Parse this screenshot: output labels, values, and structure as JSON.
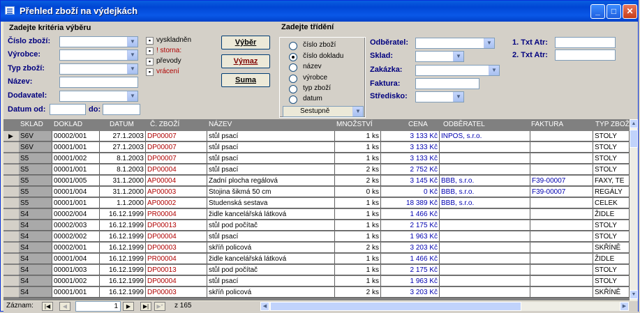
{
  "window": {
    "title": "Přehled zboží na výdejkách"
  },
  "criteria": {
    "heading": "Zadejte kritéria výběru",
    "cislo_zbozi": "Číslo zboží:",
    "vyrobce": "Výrobce:",
    "typ_zbozi": "Typ zboží:",
    "nazev": "Název:",
    "dodavatel": "Dodavatel:",
    "datum_od": "Datum od:",
    "do": "do:"
  },
  "checks": [
    {
      "label": "vyskladněn",
      "color": "#000000"
    },
    {
      "label": "! storna:",
      "color": "#b00000"
    },
    {
      "label": "převody",
      "color": "#000000"
    },
    {
      "label": "vrácení",
      "color": "#b00000"
    }
  ],
  "buttons": {
    "vyber": "Výběr",
    "vymaz": "Výmaz",
    "suma": "Suma"
  },
  "sort": {
    "heading": "Zadejte třídění",
    "options": [
      "číslo zboží",
      "číslo dokladu",
      "název",
      "výrobce",
      "typ zboží",
      "datum"
    ],
    "selected": "číslo dokladu",
    "order": "Sestupně"
  },
  "filters": {
    "odberatel": "Odběratel:",
    "sklad": "Sklad:",
    "zakazka": "Zakázka:",
    "faktura": "Faktura:",
    "stredisko": "Středisko:",
    "txt1": "1. Txt Atr:",
    "txt2": "2. Txt Atr:"
  },
  "grid": {
    "columns": [
      "SKLAD",
      "DOKLAD",
      "DATUM",
      "Č. ZBOŽÍ",
      "NÁZEV",
      "MNOŽSTVÍ",
      "CENA",
      "ODBĚRATEL",
      "FAKTURA",
      "TYP ZBOŽÍ"
    ],
    "rows": [
      [
        "S6V",
        "00002/001",
        "27.1.2003",
        "DP00007",
        "stůl psací",
        "1 ks",
        "3 133 Kč",
        "INPOS, s.r.o.",
        "",
        "STOLY"
      ],
      [
        "S6V",
        "00001/001",
        "27.1.2003",
        "DP00007",
        "stůl psací",
        "1 ks",
        "3 133 Kč",
        "",
        "",
        "STOLY"
      ],
      [
        "S5",
        "00001/002",
        "8.1.2003",
        "DP00007",
        "stůl psací",
        "1 ks",
        "3 133 Kč",
        "",
        "",
        "STOLY"
      ],
      [
        "S5",
        "00001/001",
        "8.1.2003",
        "DP00004",
        "stůl psací",
        "2 ks",
        "2 752 Kč",
        "",
        "",
        "STOLY"
      ],
      [
        "S5",
        "00001/005",
        "31.1.2000",
        "AP00004",
        "Zadní plocha regálová",
        "2 ks",
        "3 145 Kč",
        "BBB, s.r.o.",
        "F39-00007",
        "FAXY, TE"
      ],
      [
        "S5",
        "00001/004",
        "31.1.2000",
        "AP00003",
        "Stojina šikmá 50 cm",
        "0 ks",
        "0 Kč",
        "BBB, s.r.o.",
        "F39-00007",
        "REGÁLY"
      ],
      [
        "S5",
        "00001/001",
        "1.1.2000",
        "AP00002",
        "Studenská sestava",
        "1 ks",
        "18 389 Kč",
        "BBB, s.r.o.",
        "",
        "CELEK"
      ],
      [
        "S4",
        "00002/004",
        "16.12.1999",
        "PR00004",
        "židle kancelářská látková",
        "1 ks",
        "1 466 Kč",
        "",
        "",
        "ŽIDLE"
      ],
      [
        "S4",
        "00002/003",
        "16.12.1999",
        "DP00013",
        "stůl pod počítač",
        "1 ks",
        "2 175 Kč",
        "",
        "",
        "STOLY"
      ],
      [
        "S4",
        "00002/002",
        "16.12.1999",
        "DP00004",
        "stůl psací",
        "1 ks",
        "1 963 Kč",
        "",
        "",
        "STOLY"
      ],
      [
        "S4",
        "00002/001",
        "16.12.1999",
        "DP00003",
        "skříň policová",
        "2 ks",
        "3 203 Kč",
        "",
        "",
        "SKŘÍNĚ"
      ],
      [
        "S4",
        "00001/004",
        "16.12.1999",
        "PR00004",
        "židle kancelářská látková",
        "1 ks",
        "1 466 Kč",
        "",
        "",
        "ŽIDLE"
      ],
      [
        "S4",
        "00001/003",
        "16.12.1999",
        "DP00013",
        "stůl pod počítač",
        "1 ks",
        "2 175 Kč",
        "",
        "",
        "STOLY"
      ],
      [
        "S4",
        "00001/002",
        "16.12.1999",
        "DP00004",
        "stůl psací",
        "1 ks",
        "1 963 Kč",
        "",
        "",
        "STOLY"
      ],
      [
        "S4",
        "00001/001",
        "16.12.1999",
        "DP00003",
        "skříň policová",
        "2 ks",
        "3 203 Kč",
        "",
        "",
        "SKŘÍNĚ"
      ]
    ]
  },
  "status": {
    "label": "Záznam:",
    "current": "1",
    "of": "z 165"
  },
  "colors": {
    "titlebar": "#0a5ee0",
    "grid_header": "#808080",
    "code_red": "#b00000",
    "link_blue": "#0000b0"
  }
}
